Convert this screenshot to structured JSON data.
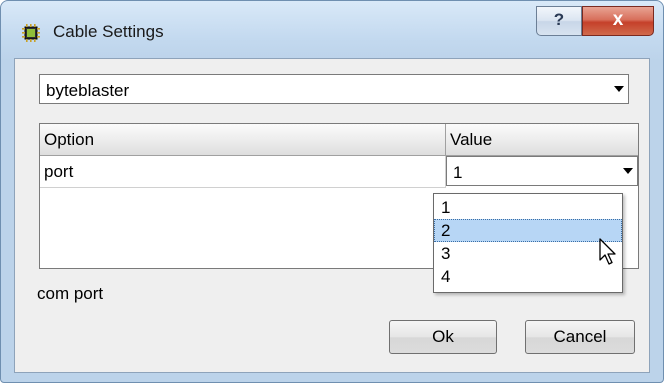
{
  "window": {
    "title": "Cable Settings",
    "help_label": "?",
    "close_label": "x"
  },
  "cable_select": {
    "value": "byteblaster"
  },
  "table": {
    "columns": [
      "Option",
      "Value"
    ],
    "rows": [
      {
        "option": "port",
        "value": "1"
      }
    ]
  },
  "value_dropdown": {
    "options": [
      "1",
      "2",
      "3",
      "4"
    ],
    "highlighted": "2"
  },
  "hint_text": "com port",
  "buttons": {
    "ok_label": "Ok",
    "cancel_label": "Cancel"
  },
  "colors": {
    "highlight": "#b7d6f5",
    "close_button": "#c5402a"
  },
  "icons": {
    "app": "chip-icon",
    "cursor": "mouse-pointer-icon",
    "dropdown": "chevron-down-icon"
  }
}
